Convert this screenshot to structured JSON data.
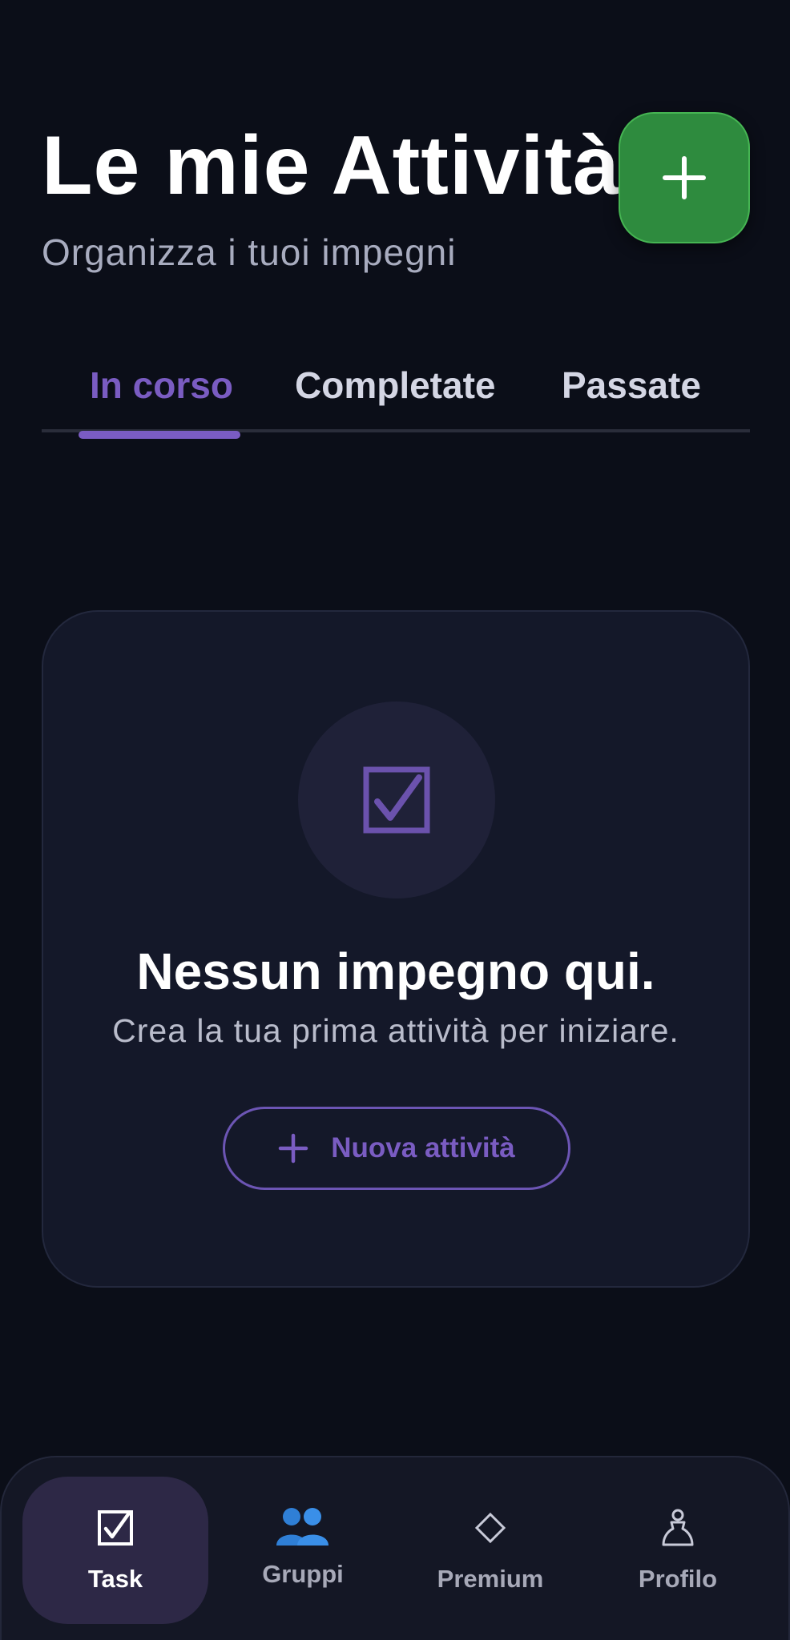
{
  "header": {
    "title": "Le mie Attività",
    "subtitle": "Organizza i tuoi impegni",
    "add_button_icon": "plus-icon"
  },
  "tabs": [
    {
      "label": "In corso",
      "active": true
    },
    {
      "label": "Completate",
      "active": false
    },
    {
      "label": "Passate",
      "active": false
    }
  ],
  "empty_state": {
    "icon": "checkbox-icon",
    "title": "Nessun impegno qui.",
    "subtitle": "Crea la tua prima attività per iniziare.",
    "button_label": "Nuova attività",
    "button_icon": "plus-icon"
  },
  "bottom_nav": [
    {
      "label": "Task",
      "icon": "checkbox-icon",
      "active": true
    },
    {
      "label": "Gruppi",
      "icon": "people-icon",
      "active": false
    },
    {
      "label": "Premium",
      "icon": "diamond-icon",
      "active": false
    },
    {
      "label": "Profilo",
      "icon": "person-icon",
      "active": false
    }
  ],
  "colors": {
    "background": "#0b0e18",
    "accent": "#7a5cc2",
    "fab_green": "#2e8b3e",
    "card": "#141829"
  }
}
